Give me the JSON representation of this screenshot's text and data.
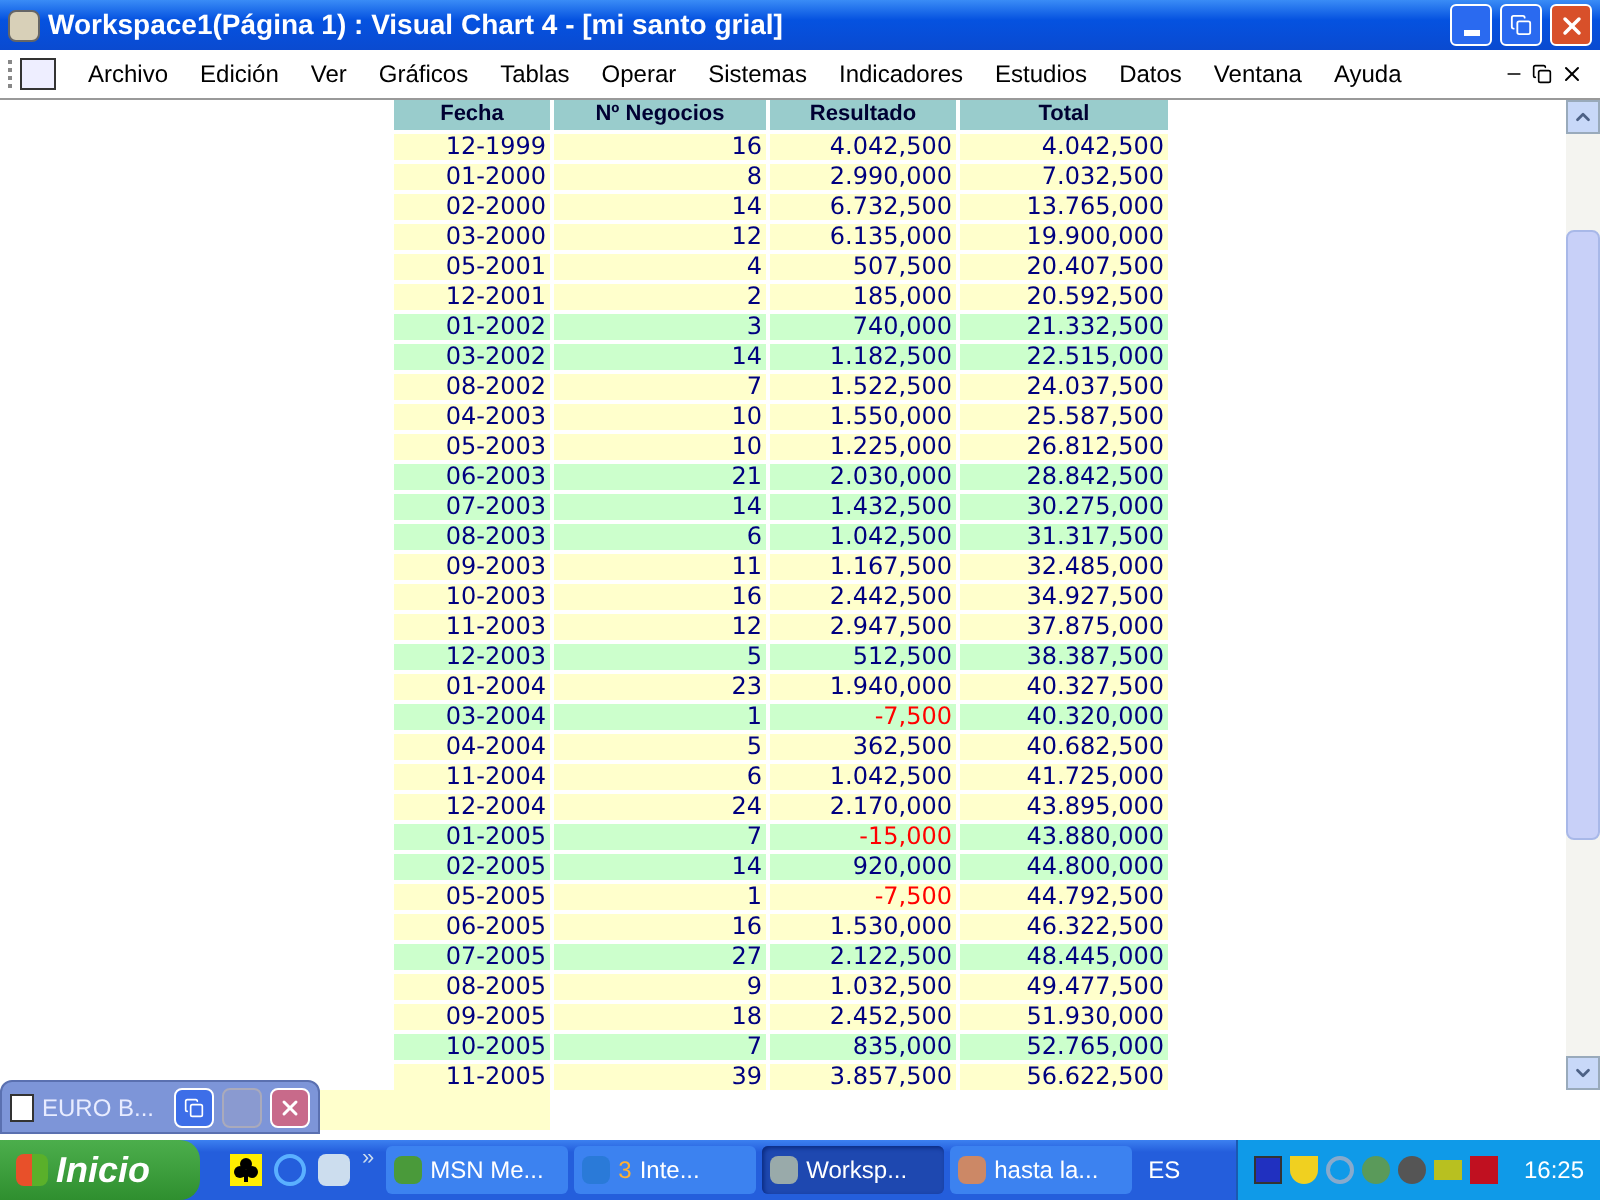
{
  "window": {
    "title": "Workspace1(Página 1) : Visual Chart 4 - [mi santo grial]"
  },
  "menu": [
    "Archivo",
    "Edición",
    "Ver",
    "Gráficos",
    "Tablas",
    "Operar",
    "Sistemas",
    "Indicadores",
    "Estudios",
    "Datos",
    "Ventana",
    "Ayuda"
  ],
  "table": {
    "columns": [
      "Fecha",
      "Nº Negocios",
      "Resultado",
      "Total"
    ],
    "rows": [
      {
        "cells": [
          "12-1999",
          "16",
          "4.042,500",
          "4.042,500"
        ],
        "highlighted": false,
        "negative": false
      },
      {
        "cells": [
          "01-2000",
          "8",
          "2.990,000",
          "7.032,500"
        ],
        "highlighted": false,
        "negative": false
      },
      {
        "cells": [
          "02-2000",
          "14",
          "6.732,500",
          "13.765,000"
        ],
        "highlighted": false,
        "negative": false
      },
      {
        "cells": [
          "03-2000",
          "12",
          "6.135,000",
          "19.900,000"
        ],
        "highlighted": false,
        "negative": false
      },
      {
        "cells": [
          "05-2001",
          "4",
          "507,500",
          "20.407,500"
        ],
        "highlighted": false,
        "negative": false
      },
      {
        "cells": [
          "12-2001",
          "2",
          "185,000",
          "20.592,500"
        ],
        "highlighted": false,
        "negative": false
      },
      {
        "cells": [
          "01-2002",
          "3",
          "740,000",
          "21.332,500"
        ],
        "highlighted": true,
        "negative": false
      },
      {
        "cells": [
          "03-2002",
          "14",
          "1.182,500",
          "22.515,000"
        ],
        "highlighted": true,
        "negative": false
      },
      {
        "cells": [
          "08-2002",
          "7",
          "1.522,500",
          "24.037,500"
        ],
        "highlighted": false,
        "negative": false
      },
      {
        "cells": [
          "04-2003",
          "10",
          "1.550,000",
          "25.587,500"
        ],
        "highlighted": false,
        "negative": false
      },
      {
        "cells": [
          "05-2003",
          "10",
          "1.225,000",
          "26.812,500"
        ],
        "highlighted": false,
        "negative": false
      },
      {
        "cells": [
          "06-2003",
          "21",
          "2.030,000",
          "28.842,500"
        ],
        "highlighted": true,
        "negative": false
      },
      {
        "cells": [
          "07-2003",
          "14",
          "1.432,500",
          "30.275,000"
        ],
        "highlighted": true,
        "negative": false
      },
      {
        "cells": [
          "08-2003",
          "6",
          "1.042,500",
          "31.317,500"
        ],
        "highlighted": true,
        "negative": false
      },
      {
        "cells": [
          "09-2003",
          "11",
          "1.167,500",
          "32.485,000"
        ],
        "highlighted": false,
        "negative": false
      },
      {
        "cells": [
          "10-2003",
          "16",
          "2.442,500",
          "34.927,500"
        ],
        "highlighted": false,
        "negative": false
      },
      {
        "cells": [
          "11-2003",
          "12",
          "2.947,500",
          "37.875,000"
        ],
        "highlighted": false,
        "negative": false
      },
      {
        "cells": [
          "12-2003",
          "5",
          "512,500",
          "38.387,500"
        ],
        "highlighted": true,
        "negative": false
      },
      {
        "cells": [
          "01-2004",
          "23",
          "1.940,000",
          "40.327,500"
        ],
        "highlighted": false,
        "negative": false
      },
      {
        "cells": [
          "03-2004",
          "1",
          "-7,500",
          "40.320,000"
        ],
        "highlighted": true,
        "negative": true
      },
      {
        "cells": [
          "04-2004",
          "5",
          "362,500",
          "40.682,500"
        ],
        "highlighted": false,
        "negative": false
      },
      {
        "cells": [
          "11-2004",
          "6",
          "1.042,500",
          "41.725,000"
        ],
        "highlighted": false,
        "negative": false
      },
      {
        "cells": [
          "12-2004",
          "24",
          "2.170,000",
          "43.895,000"
        ],
        "highlighted": false,
        "negative": false
      },
      {
        "cells": [
          "01-2005",
          "7",
          "-15,000",
          "43.880,000"
        ],
        "highlighted": true,
        "negative": true
      },
      {
        "cells": [
          "02-2005",
          "14",
          "920,000",
          "44.800,000"
        ],
        "highlighted": true,
        "negative": false
      },
      {
        "cells": [
          "05-2005",
          "1",
          "-7,500",
          "44.792,500"
        ],
        "highlighted": false,
        "negative": true
      },
      {
        "cells": [
          "06-2005",
          "16",
          "1.530,000",
          "46.322,500"
        ],
        "highlighted": false,
        "negative": false
      },
      {
        "cells": [
          "07-2005",
          "27",
          "2.122,500",
          "48.445,000"
        ],
        "highlighted": true,
        "negative": false
      },
      {
        "cells": [
          "08-2005",
          "9",
          "1.032,500",
          "49.477,500"
        ],
        "highlighted": false,
        "negative": false
      },
      {
        "cells": [
          "09-2005",
          "18",
          "2.452,500",
          "51.930,000"
        ],
        "highlighted": false,
        "negative": false
      },
      {
        "cells": [
          "10-2005",
          "7",
          "835,000",
          "52.765,000"
        ],
        "highlighted": true,
        "negative": false
      },
      {
        "cells": [
          "11-2005",
          "39",
          "3.857,500",
          "56.622,500"
        ],
        "highlighted": false,
        "negative": false
      }
    ]
  },
  "minimized_window": {
    "title": "EURO B..."
  },
  "taskbar": {
    "start": "Inicio",
    "overflow": "»",
    "tasks": [
      {
        "label": "MSN Me...",
        "selected": false
      },
      {
        "label": "Inte...",
        "count": "3",
        "selected": false
      },
      {
        "label": "Worksp...",
        "selected": true
      },
      {
        "label": "hasta la...",
        "selected": false
      }
    ],
    "language": "ES",
    "clock": "16:25"
  }
}
